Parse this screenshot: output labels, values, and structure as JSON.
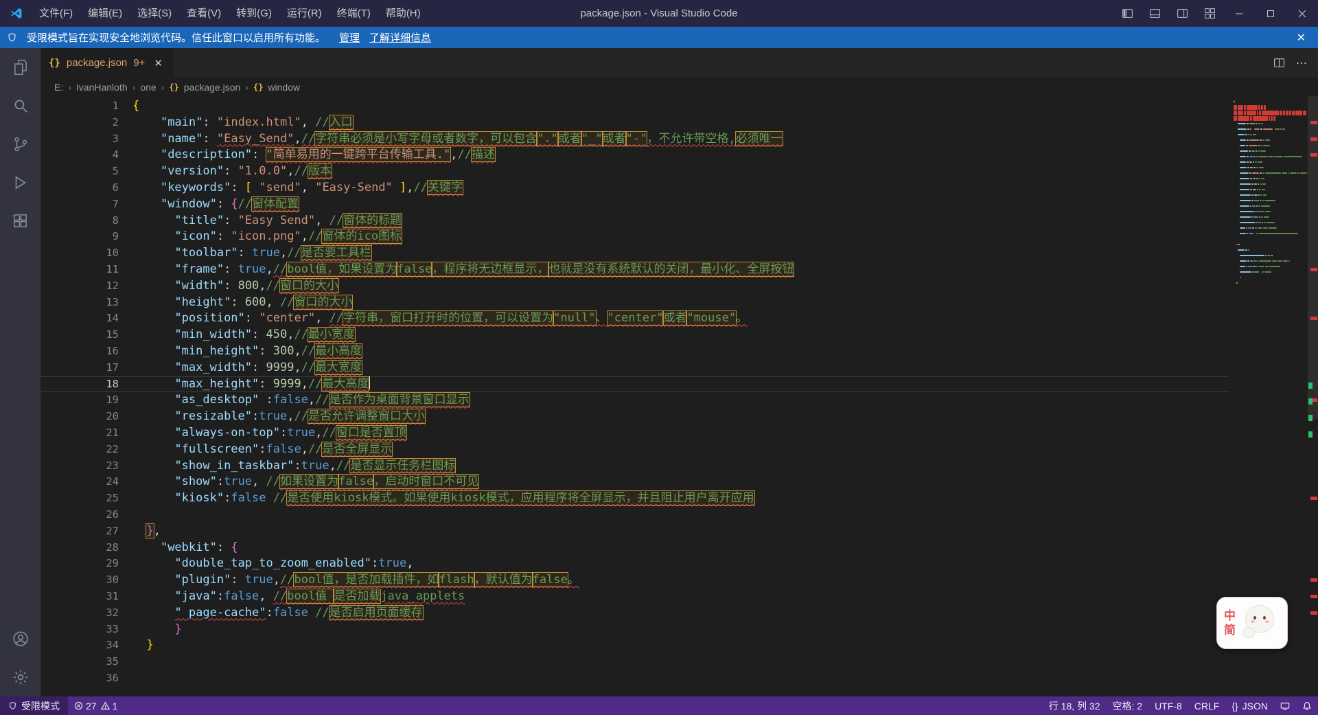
{
  "titlebar": {
    "title": "package.json - Visual Studio Code",
    "menus": [
      "文件(F)",
      "编辑(E)",
      "选择(S)",
      "查看(V)",
      "转到(G)",
      "运行(R)",
      "终端(T)",
      "帮助(H)"
    ]
  },
  "banner": {
    "message": "受限模式旨在实现安全地浏览代码。信任此窗口以启用所有功能。",
    "manage_link": "管理",
    "learn_more_link": "了解详细信息",
    "close": "✕"
  },
  "activitybar": {
    "icons": [
      "explorer-icon",
      "search-icon",
      "source-control-icon",
      "run-debug-icon",
      "extensions-icon",
      "account-icon",
      "settings-gear-icon"
    ]
  },
  "tab": {
    "braces_icon": "{}",
    "label": "package.json",
    "badge": "9+",
    "close": "✕"
  },
  "editor_actions": {
    "more": "⋯"
  },
  "breadcrumb": {
    "segments": [
      "E:",
      "IvanHanloth",
      "one",
      "package.json",
      "window"
    ],
    "separator": "›",
    "braces_icon": "{}"
  },
  "editor": {
    "current_line": 18,
    "error_lines": [
      2,
      3,
      4
    ],
    "overview_errors": [
      2,
      3,
      4,
      11,
      14,
      19,
      25,
      30,
      31,
      32
    ],
    "overview_greens": [
      18,
      19,
      20,
      21
    ],
    "lines": [
      {
        "n": 1,
        "t": [
          [
            "{",
            "br1"
          ]
        ]
      },
      {
        "n": 2,
        "t": [
          [
            "    ",
            ""
          ],
          [
            "\"main\"",
            "k"
          ],
          [
            ": ",
            "p"
          ],
          [
            "\"index.html\"",
            "s"
          ],
          [
            ", ",
            "p"
          ],
          [
            "//",
            "c"
          ],
          [
            "入口",
            "c box sq"
          ]
        ]
      },
      {
        "n": 3,
        "t": [
          [
            "    ",
            ""
          ],
          [
            "\"name\"",
            "k"
          ],
          [
            ": ",
            "p"
          ],
          [
            "\"Easy_Send\"",
            "s sq"
          ],
          [
            ",",
            "p"
          ],
          [
            "//",
            "c sq"
          ],
          [
            "字符串必须是小写字母或者数字，可以包含",
            "c box sq"
          ],
          [
            "\".\"",
            "c box sq"
          ],
          [
            "或者",
            "c box sq"
          ],
          [
            "\"_\"",
            "c box sq"
          ],
          [
            "或者",
            "c box sq"
          ],
          [
            "\"-\"",
            "c box sq"
          ],
          [
            "，不允许带空格,",
            "c sq"
          ],
          [
            "必须唯一",
            "c box sq"
          ]
        ]
      },
      {
        "n": 4,
        "t": [
          [
            "    ",
            ""
          ],
          [
            "\"description\"",
            "k"
          ],
          [
            ": ",
            "p"
          ],
          [
            "\"简单易用的一键跨平台传输工具.\"",
            "s box sq"
          ],
          [
            ",",
            "p"
          ],
          [
            "//",
            "c"
          ],
          [
            "描述",
            "c box sq"
          ]
        ]
      },
      {
        "n": 5,
        "t": [
          [
            "    ",
            ""
          ],
          [
            "\"version\"",
            "k"
          ],
          [
            ": ",
            "p"
          ],
          [
            "\"1.0.0\"",
            "s"
          ],
          [
            ",",
            "p"
          ],
          [
            "//",
            "c"
          ],
          [
            "版本",
            "c box sq"
          ]
        ]
      },
      {
        "n": 6,
        "t": [
          [
            "    ",
            ""
          ],
          [
            "\"keywords\"",
            "k"
          ],
          [
            ": ",
            "p"
          ],
          [
            "[",
            "br1"
          ],
          [
            " ",
            "p"
          ],
          [
            "\"send\"",
            "s"
          ],
          [
            ", ",
            "p"
          ],
          [
            "\"Easy-Send\"",
            "s"
          ],
          [
            " ",
            "p"
          ],
          [
            "]",
            "br1"
          ],
          [
            ",",
            "p"
          ],
          [
            "//",
            "c"
          ],
          [
            "关键字",
            "c box sq"
          ]
        ]
      },
      {
        "n": 7,
        "t": [
          [
            "    ",
            ""
          ],
          [
            "\"window\"",
            "k"
          ],
          [
            ": ",
            "p"
          ],
          [
            "{",
            "br2"
          ],
          [
            "//",
            "c"
          ],
          [
            "窗体配置",
            "c box sq"
          ]
        ]
      },
      {
        "n": 8,
        "t": [
          [
            "      ",
            ""
          ],
          [
            "\"title\"",
            "k"
          ],
          [
            ": ",
            "p"
          ],
          [
            "\"Easy Send\"",
            "s"
          ],
          [
            ", ",
            "p"
          ],
          [
            "//",
            "c"
          ],
          [
            "窗体的标题",
            "c box sq"
          ]
        ]
      },
      {
        "n": 9,
        "t": [
          [
            "      ",
            ""
          ],
          [
            "\"icon\"",
            "k"
          ],
          [
            ": ",
            "p"
          ],
          [
            "\"icon.png\"",
            "s"
          ],
          [
            ",",
            "p"
          ],
          [
            "//",
            "c"
          ],
          [
            "窗体的ico图标",
            "c box sq"
          ]
        ]
      },
      {
        "n": 10,
        "t": [
          [
            "      ",
            ""
          ],
          [
            "\"toolbar\"",
            "k"
          ],
          [
            ": ",
            "p"
          ],
          [
            "true",
            "b"
          ],
          [
            ",",
            "p"
          ],
          [
            "//",
            "c"
          ],
          [
            "是否要工具栏",
            "c box sq"
          ]
        ]
      },
      {
        "n": 11,
        "t": [
          [
            "      ",
            ""
          ],
          [
            "\"frame\"",
            "k"
          ],
          [
            ": ",
            "p"
          ],
          [
            "true",
            "b"
          ],
          [
            ",",
            "p"
          ],
          [
            "//",
            "c sq"
          ],
          [
            "bool值，如果设置为",
            "c box sq"
          ],
          [
            "false",
            "c box sq"
          ],
          [
            "，程序将无边框显示，",
            "c box sq"
          ],
          [
            "也就是没有系统默认的关闭，最小化、全屏按钮",
            "c box sq"
          ]
        ]
      },
      {
        "n": 12,
        "t": [
          [
            "      ",
            ""
          ],
          [
            "\"width\"",
            "k"
          ],
          [
            ": ",
            "p"
          ],
          [
            "800",
            "n"
          ],
          [
            ",",
            "p"
          ],
          [
            "//",
            "c"
          ],
          [
            "窗口的大小",
            "c box sq"
          ]
        ]
      },
      {
        "n": 13,
        "t": [
          [
            "      ",
            ""
          ],
          [
            "\"height\"",
            "k"
          ],
          [
            ": ",
            "p"
          ],
          [
            "600",
            "n"
          ],
          [
            ", ",
            "p"
          ],
          [
            "//",
            "c"
          ],
          [
            "窗口的大小",
            "c box sq"
          ]
        ]
      },
      {
        "n": 14,
        "t": [
          [
            "      ",
            ""
          ],
          [
            "\"position\"",
            "k"
          ],
          [
            ": ",
            "p"
          ],
          [
            "\"center\"",
            "s"
          ],
          [
            ", ",
            "p"
          ],
          [
            "//",
            "c sq"
          ],
          [
            "字符串，窗口打开时的位置，可以设置为",
            "c box sq"
          ],
          [
            "\"null\"",
            "c box sq"
          ],
          [
            "、",
            "c sq"
          ],
          [
            "\"center\"",
            "c box sq"
          ],
          [
            "或者",
            "c box sq"
          ],
          [
            "\"mouse\"",
            "c box sq"
          ],
          [
            "。",
            "c sq"
          ]
        ]
      },
      {
        "n": 15,
        "t": [
          [
            "      ",
            ""
          ],
          [
            "\"min_width\"",
            "k"
          ],
          [
            ": ",
            "p"
          ],
          [
            "450",
            "n"
          ],
          [
            ",",
            "p"
          ],
          [
            "//",
            "c"
          ],
          [
            "最小宽度",
            "c box sq"
          ]
        ]
      },
      {
        "n": 16,
        "t": [
          [
            "      ",
            ""
          ],
          [
            "\"min_height\"",
            "k"
          ],
          [
            ": ",
            "p"
          ],
          [
            "300",
            "n"
          ],
          [
            ",",
            "p"
          ],
          [
            "//",
            "c"
          ],
          [
            "最小高度",
            "c box sq"
          ]
        ]
      },
      {
        "n": 17,
        "t": [
          [
            "      ",
            ""
          ],
          [
            "\"max_width\"",
            "k"
          ],
          [
            ": ",
            "p"
          ],
          [
            "9999",
            "n"
          ],
          [
            ",",
            "p"
          ],
          [
            "//",
            "c"
          ],
          [
            "最大宽度",
            "c box sq"
          ]
        ]
      },
      {
        "n": 18,
        "t": [
          [
            "      ",
            ""
          ],
          [
            "\"max_height\"",
            "k"
          ],
          [
            ": ",
            "p"
          ],
          [
            "9999",
            "n"
          ],
          [
            ",",
            "p"
          ],
          [
            "//",
            "c"
          ],
          [
            "最大高度",
            "c box sq"
          ]
        ]
      },
      {
        "n": 19,
        "t": [
          [
            "      ",
            ""
          ],
          [
            "\"as_desktop\"",
            "k"
          ],
          [
            " :",
            "p"
          ],
          [
            "false",
            "b"
          ],
          [
            ",",
            "p"
          ],
          [
            "//",
            "c"
          ],
          [
            "是否作为桌面背景窗口显示",
            "c box sq"
          ]
        ]
      },
      {
        "n": 20,
        "t": [
          [
            "      ",
            ""
          ],
          [
            "\"resizable\"",
            "k"
          ],
          [
            ":",
            "p"
          ],
          [
            "true",
            "b"
          ],
          [
            ",",
            "p"
          ],
          [
            "//",
            "c"
          ],
          [
            "是否允许调整窗口大小",
            "c box sq"
          ]
        ]
      },
      {
        "n": 21,
        "t": [
          [
            "      ",
            ""
          ],
          [
            "\"always-on-top\"",
            "k"
          ],
          [
            ":",
            "p"
          ],
          [
            "true",
            "b"
          ],
          [
            ",",
            "p"
          ],
          [
            "//",
            "c"
          ],
          [
            "窗口是否置顶",
            "c box sq"
          ]
        ]
      },
      {
        "n": 22,
        "t": [
          [
            "      ",
            ""
          ],
          [
            "\"fullscreen\"",
            "k"
          ],
          [
            ":",
            "p"
          ],
          [
            "false",
            "b"
          ],
          [
            ",",
            "p"
          ],
          [
            "//",
            "c"
          ],
          [
            "是否全屏显示",
            "c box sq"
          ]
        ]
      },
      {
        "n": 23,
        "t": [
          [
            "      ",
            ""
          ],
          [
            "\"show_in_taskbar\"",
            "k"
          ],
          [
            ":",
            "p"
          ],
          [
            "true",
            "b"
          ],
          [
            ",",
            "p"
          ],
          [
            "//",
            "c"
          ],
          [
            "是否显示任务栏图标",
            "c box sq"
          ]
        ]
      },
      {
        "n": 24,
        "t": [
          [
            "      ",
            ""
          ],
          [
            "\"show\"",
            "k"
          ],
          [
            ":",
            "p"
          ],
          [
            "true",
            "b"
          ],
          [
            ", ",
            "p"
          ],
          [
            "//",
            "c"
          ],
          [
            "如果设置为",
            "c box sq"
          ],
          [
            "false",
            "c box sq"
          ],
          [
            "，启动时窗口不可见",
            "c box sq"
          ]
        ]
      },
      {
        "n": 25,
        "t": [
          [
            "      ",
            ""
          ],
          [
            "\"kiosk\"",
            "k"
          ],
          [
            ":",
            "p"
          ],
          [
            "false",
            "b"
          ],
          [
            " ",
            "p"
          ],
          [
            "//",
            "c"
          ],
          [
            "是否使用kiosk模式。如果使用kiosk模式，应用程序将全屏显示，并且阻止用户离开应用",
            "c box sq"
          ]
        ]
      },
      {
        "n": 26,
        "t": []
      },
      {
        "n": 27,
        "t": [
          [
            "  ",
            ""
          ],
          [
            "}",
            "br2 box"
          ],
          [
            ",",
            "p"
          ]
        ]
      },
      {
        "n": 28,
        "t": [
          [
            "    ",
            ""
          ],
          [
            "\"webkit\"",
            "k"
          ],
          [
            ": ",
            "p"
          ],
          [
            "{",
            "br2"
          ]
        ]
      },
      {
        "n": 29,
        "t": [
          [
            "      ",
            ""
          ],
          [
            "\"double_tap_to_zoom_enabled\"",
            "k"
          ],
          [
            ":",
            "p"
          ],
          [
            "true",
            "b"
          ],
          [
            ",",
            "p"
          ]
        ]
      },
      {
        "n": 30,
        "t": [
          [
            "      ",
            ""
          ],
          [
            "\"plugin\"",
            "k"
          ],
          [
            ": ",
            "p"
          ],
          [
            "true",
            "b"
          ],
          [
            ",",
            "p"
          ],
          [
            "//",
            "c sq"
          ],
          [
            "bool值，是否加载插件，如",
            "c box sq"
          ],
          [
            "flash",
            "c box sq"
          ],
          [
            "，默认值为",
            "c box sq"
          ],
          [
            "false",
            "c box sq"
          ],
          [
            "。",
            "c sq"
          ]
        ]
      },
      {
        "n": 31,
        "t": [
          [
            "      ",
            ""
          ],
          [
            "\"java\"",
            "k"
          ],
          [
            ":",
            "p"
          ],
          [
            "false",
            "b"
          ],
          [
            ", ",
            "p"
          ],
          [
            "//",
            "c sq"
          ],
          [
            "bool值 ",
            "c box sq"
          ],
          [
            "是否加载",
            "c box sq"
          ],
          [
            "java_applets",
            "c sq"
          ]
        ]
      },
      {
        "n": 32,
        "t": [
          [
            "      ",
            ""
          ],
          [
            "\" page-cache\"",
            "k sq"
          ],
          [
            ":",
            "p"
          ],
          [
            "false",
            "b"
          ],
          [
            " ",
            "p"
          ],
          [
            "//",
            "c"
          ],
          [
            "是否启用页面缓存",
            "c box sq"
          ]
        ]
      },
      {
        "n": 33,
        "t": [
          [
            "      ",
            ""
          ],
          [
            "}",
            "br2"
          ]
        ]
      },
      {
        "n": 34,
        "t": [
          [
            "  ",
            ""
          ],
          [
            "}",
            "br1"
          ]
        ]
      },
      {
        "n": 35,
        "t": []
      },
      {
        "n": 36,
        "t": []
      }
    ]
  },
  "statusbar": {
    "restricted": "受限模式",
    "errors": "27",
    "warnings": "1",
    "cursor": "行 18, 列 32",
    "indent": "空格: 2",
    "encoding": "UTF-8",
    "eol": "CRLF",
    "language_icon": "{}",
    "language": "JSON"
  },
  "ime": {
    "top": "中",
    "bottom": "简"
  }
}
